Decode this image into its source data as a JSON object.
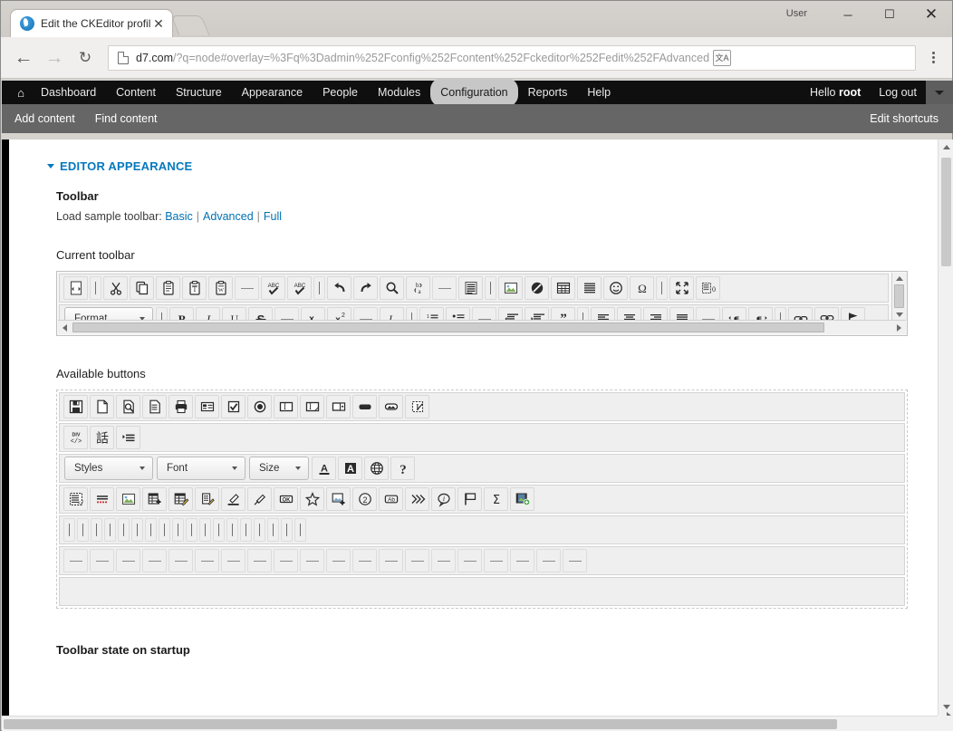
{
  "browser": {
    "tab_title": "Edit the CKEditor profile",
    "tab_close_glyph": "✕",
    "user_label": "User",
    "window_minimize": "─",
    "window_maximize": "☐",
    "window_close": "✕",
    "nav": {
      "back": "←",
      "forward": "→",
      "reload": "↻"
    },
    "url_domain": "d7.com",
    "url_path": "/?q=node#overlay=%3Fq%3Dadmin%252Fconfig%252Fcontent%252Fckeditor%252Fedit%252FAdvanced",
    "translate_label": "文A",
    "accent_color": "#0678be"
  },
  "admin_bar": {
    "home_glyph": "⌂",
    "items": [
      {
        "label": "Dashboard",
        "active": false
      },
      {
        "label": "Content",
        "active": false
      },
      {
        "label": "Structure",
        "active": false
      },
      {
        "label": "Appearance",
        "active": false
      },
      {
        "label": "People",
        "active": false
      },
      {
        "label": "Modules",
        "active": false
      },
      {
        "label": "Configuration",
        "active": true
      },
      {
        "label": "Reports",
        "active": false
      },
      {
        "label": "Help",
        "active": false
      }
    ],
    "greeting_prefix": "Hello ",
    "username": "root",
    "logout": "Log out",
    "shortcuts": [
      "Add content",
      "Find content"
    ],
    "edit_shortcuts": "Edit shortcuts"
  },
  "page": {
    "fieldset_title": "EDITOR APPEARANCE",
    "toolbar_heading": "Toolbar",
    "sample_prefix": "Load sample toolbar: ",
    "sample_links": [
      "Basic",
      "Advanced",
      "Full"
    ],
    "sample_separator": "|",
    "current_toolbar_label": "Current toolbar",
    "available_buttons_label": "Available buttons",
    "startup_label": "Toolbar state on startup"
  },
  "current_toolbar": {
    "rows": [
      [
        {
          "type": "button",
          "icon": "source-icon",
          "title": "Source"
        },
        {
          "type": "sep-v",
          "icon": "separator-icon"
        },
        {
          "type": "button",
          "icon": "cut-icon",
          "title": "Cut"
        },
        {
          "type": "button",
          "icon": "copy-icon",
          "title": "Copy"
        },
        {
          "type": "button",
          "icon": "paste-icon",
          "title": "Paste"
        },
        {
          "type": "button",
          "icon": "paste-text-icon",
          "title": "Paste as plain text"
        },
        {
          "type": "button",
          "icon": "paste-word-icon",
          "title": "Paste from Word"
        },
        {
          "type": "sep-h",
          "icon": "separator-dash-icon"
        },
        {
          "type": "button",
          "icon": "spellcheck-icon",
          "title": "Check spelling"
        },
        {
          "type": "button",
          "icon": "scayt-icon",
          "title": "Spell check as you type"
        },
        {
          "type": "sep-v",
          "icon": "separator-icon"
        },
        {
          "type": "button",
          "icon": "undo-icon",
          "title": "Undo"
        },
        {
          "type": "button",
          "icon": "redo-icon",
          "title": "Redo"
        },
        {
          "type": "button",
          "icon": "find-icon",
          "title": "Find"
        },
        {
          "type": "button",
          "icon": "replace-icon",
          "title": "Replace"
        },
        {
          "type": "sep-h",
          "icon": "separator-dash-icon"
        },
        {
          "type": "button",
          "icon": "select-all-icon",
          "title": "Select All"
        },
        {
          "type": "sep-v",
          "icon": "separator-icon"
        },
        {
          "type": "button",
          "icon": "image-icon",
          "title": "Image"
        },
        {
          "type": "button",
          "icon": "flash-icon",
          "title": "Flash"
        },
        {
          "type": "button",
          "icon": "table-icon",
          "title": "Table"
        },
        {
          "type": "button",
          "icon": "horizontal-rule-icon",
          "title": "Horizontal Line"
        },
        {
          "type": "button",
          "icon": "smiley-icon",
          "title": "Smiley"
        },
        {
          "type": "button",
          "icon": "special-char-icon",
          "title": "Special Character"
        },
        {
          "type": "sep-v",
          "icon": "separator-icon"
        },
        {
          "type": "button",
          "icon": "maximize-icon",
          "title": "Maximize"
        },
        {
          "type": "button",
          "icon": "show-blocks-icon",
          "title": "Show Blocks"
        }
      ],
      [
        {
          "type": "combo",
          "icon": "format-dropdown",
          "label": "Format",
          "width": "combo-format"
        },
        {
          "type": "sep-v",
          "icon": "separator-icon"
        },
        {
          "type": "button",
          "icon": "bold-icon",
          "title": "Bold"
        },
        {
          "type": "button",
          "icon": "italic-icon",
          "title": "Italic"
        },
        {
          "type": "button",
          "icon": "underline-icon",
          "title": "Underline"
        },
        {
          "type": "button",
          "icon": "strike-icon",
          "title": "Strike Through"
        },
        {
          "type": "sep-h",
          "icon": "separator-dash-icon"
        },
        {
          "type": "button",
          "icon": "subscript-icon",
          "title": "Subscript"
        },
        {
          "type": "button",
          "icon": "superscript-icon",
          "title": "Superscript"
        },
        {
          "type": "sep-h",
          "icon": "separator-dash-icon"
        },
        {
          "type": "button",
          "icon": "remove-format-icon",
          "title": "Remove Format"
        },
        {
          "type": "sep-v",
          "icon": "separator-icon"
        },
        {
          "type": "button",
          "icon": "numbered-list-icon",
          "title": "Numbered List"
        },
        {
          "type": "button",
          "icon": "bulleted-list-icon",
          "title": "Bulleted List"
        },
        {
          "type": "sep-h",
          "icon": "separator-dash-icon"
        },
        {
          "type": "button",
          "icon": "outdent-icon",
          "title": "Decrease Indent"
        },
        {
          "type": "button",
          "icon": "indent-icon",
          "title": "Increase Indent"
        },
        {
          "type": "button",
          "icon": "blockquote-icon",
          "title": "Block Quote"
        },
        {
          "type": "sep-v",
          "icon": "separator-icon"
        },
        {
          "type": "button",
          "icon": "align-left-icon",
          "title": "Align Left"
        },
        {
          "type": "button",
          "icon": "align-center-icon",
          "title": "Center"
        },
        {
          "type": "button",
          "icon": "align-right-icon",
          "title": "Align Right"
        },
        {
          "type": "button",
          "icon": "align-justify-icon",
          "title": "Justify"
        },
        {
          "type": "sep-h",
          "icon": "separator-dash-icon"
        },
        {
          "type": "button",
          "icon": "text-direction-ltr-icon",
          "title": "Text direction left to right"
        },
        {
          "type": "button",
          "icon": "text-direction-rtl-icon",
          "title": "Text direction right to left"
        },
        {
          "type": "sep-v",
          "icon": "separator-icon"
        },
        {
          "type": "button",
          "icon": "link-icon",
          "title": "Link"
        },
        {
          "type": "button",
          "icon": "unlink-icon",
          "title": "Unlink"
        },
        {
          "type": "button",
          "icon": "anchor-icon",
          "title": "Anchor"
        }
      ]
    ]
  },
  "available_buttons": {
    "rows": [
      [
        {
          "type": "button",
          "icon": "save-icon",
          "title": "Save"
        },
        {
          "type": "button",
          "icon": "new-page-icon",
          "title": "New Page"
        },
        {
          "type": "button",
          "icon": "preview-icon",
          "title": "Preview"
        },
        {
          "type": "button",
          "icon": "templates-icon",
          "title": "Templates"
        },
        {
          "type": "button",
          "icon": "print-icon",
          "title": "Print"
        },
        {
          "type": "button",
          "icon": "form-icon",
          "title": "Form"
        },
        {
          "type": "button",
          "icon": "checkbox-icon",
          "title": "Checkbox"
        },
        {
          "type": "button",
          "icon": "radio-button-icon",
          "title": "Radio Button"
        },
        {
          "type": "button",
          "icon": "text-field-icon",
          "title": "Text Field"
        },
        {
          "type": "button",
          "icon": "textarea-icon",
          "title": "Textarea"
        },
        {
          "type": "button",
          "icon": "select-field-icon",
          "title": "Selection Field"
        },
        {
          "type": "button",
          "icon": "button-icon",
          "title": "Button"
        },
        {
          "type": "button",
          "icon": "image-button-icon",
          "title": "Image Button"
        },
        {
          "type": "button",
          "icon": "hidden-field-icon",
          "title": "Hidden Field"
        }
      ],
      [
        {
          "type": "button",
          "icon": "div-container-icon",
          "title": "Create Div Container"
        },
        {
          "type": "button",
          "icon": "language-icon",
          "title": "Set Language"
        },
        {
          "type": "button",
          "icon": "list-properties-icon",
          "title": "List Properties"
        }
      ],
      [
        {
          "type": "combo",
          "icon": "styles-dropdown",
          "label": "Styles",
          "width": "combo-styles"
        },
        {
          "type": "combo",
          "icon": "font-dropdown",
          "label": "Font",
          "width": "combo-font"
        },
        {
          "type": "combo",
          "icon": "size-dropdown",
          "label": "Size",
          "width": "combo-size"
        },
        {
          "type": "button",
          "icon": "text-color-icon",
          "title": "Text Color"
        },
        {
          "type": "button",
          "icon": "background-color-icon",
          "title": "Background Color"
        },
        {
          "type": "button",
          "icon": "about-icon",
          "title": "About CKEditor"
        },
        {
          "type": "button",
          "icon": "help-icon",
          "title": "Help"
        }
      ],
      [
        {
          "type": "button",
          "icon": "source-dialog-icon",
          "title": "Source dialog"
        },
        {
          "type": "button",
          "icon": "spell-underline-icon",
          "title": "Spell check"
        },
        {
          "type": "button",
          "icon": "image-alt-icon",
          "title": "Image"
        },
        {
          "type": "button",
          "icon": "table-insert-icon",
          "title": "Insert table"
        },
        {
          "type": "button",
          "icon": "table-edit-icon",
          "title": "Edit table"
        },
        {
          "type": "button",
          "icon": "paste-edit-icon",
          "title": "Paste"
        },
        {
          "type": "button",
          "icon": "highlight-marker-icon",
          "title": "Marker"
        },
        {
          "type": "button",
          "icon": "eraser-icon",
          "title": "Eraser"
        },
        {
          "type": "button",
          "icon": "ok-button-icon",
          "title": "OK button"
        },
        {
          "type": "button",
          "icon": "star-icon",
          "title": "Favourite"
        },
        {
          "type": "button",
          "icon": "add-image-icon",
          "title": "Add image"
        },
        {
          "type": "button",
          "icon": "number-two-icon",
          "title": "Second"
        },
        {
          "type": "button",
          "icon": "abbreviation-icon",
          "title": "Abbreviation"
        },
        {
          "type": "button",
          "icon": "chevrons-right-icon",
          "title": "More"
        },
        {
          "type": "button",
          "icon": "comment-icon",
          "title": "Comment"
        },
        {
          "type": "button",
          "icon": "flag-outline-icon",
          "title": "Flag"
        },
        {
          "type": "button",
          "icon": "sigma-icon",
          "title": "Sum"
        },
        {
          "type": "button",
          "icon": "add-media-icon",
          "title": "Add media"
        }
      ],
      [
        {
          "type": "sep-v",
          "icon": "separator-icon",
          "count": 18
        }
      ],
      [
        {
          "type": "sep-h",
          "icon": "separator-dash-icon",
          "count": 20
        }
      ],
      []
    ]
  }
}
